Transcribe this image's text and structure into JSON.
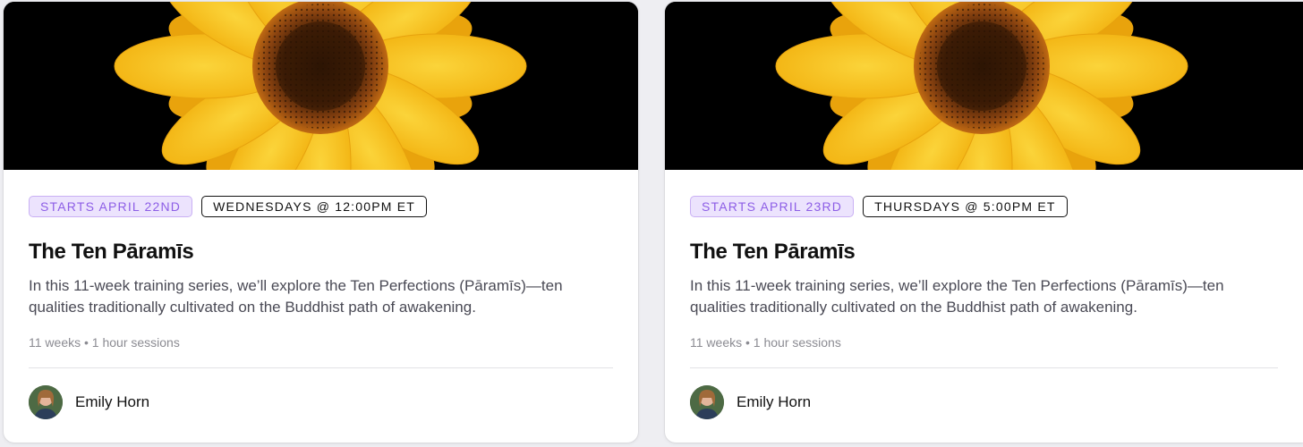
{
  "cards": [
    {
      "start_badge": "STARTS APRIL 22ND",
      "time_badge": "WEDNESDAYS @ 12:00PM ET",
      "title": "The Ten Pāramīs",
      "description": "In this 11-week training series, we’ll explore the Ten Perfections (Pāramīs)—ten qualities traditionally cultivated on the Buddhist path of awakening.",
      "meta": "11 weeks • 1 hour sessions",
      "author": "Emily Horn",
      "image": "sunflower-image"
    },
    {
      "start_badge": "STARTS APRIL 23RD",
      "time_badge": "THURSDAYS @ 5:00PM ET",
      "title": "The Ten Pāramīs",
      "description": "In this 11-week training series, we’ll explore the Ten Perfections (Pāramīs)—ten qualities traditionally cultivated on the Buddhist path of awakening.",
      "meta": "11 weeks • 1 hour sessions",
      "author": "Emily Horn",
      "image": "sunflower-image"
    }
  ],
  "colors": {
    "start_badge_bg": "#ece3fd",
    "start_badge_text": "#8d5ee6",
    "petal": "#f9c81b",
    "petal_dark": "#e9a30c",
    "center": "#5a2a06"
  }
}
